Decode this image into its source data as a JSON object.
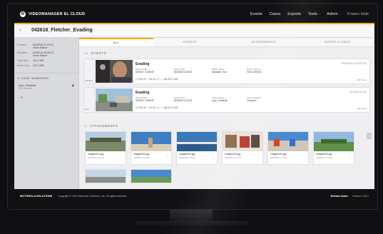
{
  "app": {
    "logo_letter": "M",
    "brand": "VIDEOMANAGER EL CLOUD"
  },
  "topnav": {
    "events": "Events",
    "cases": "Cases",
    "exports": "Exports",
    "tools": "Tools ·",
    "admin": "Admin ·",
    "user": "Kristen Hale"
  },
  "case": {
    "back": "‹",
    "title": "042618_Fletcher_Evading"
  },
  "sidebar": {
    "fields": [
      {
        "k": "Created",
        "v": "04/26/18 11:29:23",
        "v2": "Devin Blauer"
      },
      {
        "k": "Modified",
        "v": "04/26/18 15:26:13",
        "v2": "Devin Blauer"
      },
      {
        "k": "Total Size",
        "v": "115.3 MB",
        "v2": ""
      },
      {
        "k": "Event Size",
        "v": "107.1 MB",
        "v2": ""
      }
    ],
    "case_workers_heading": "CASE WORKERS",
    "worker_name": "Lyon, Christina",
    "worker_role": "Full Access",
    "add": "+"
  },
  "tabs": [
    "ALL",
    "EVENTS",
    "ATTACHMENTS",
    "NOTES & LINKS"
  ],
  "events_heading": "EVENTS",
  "events": [
    {
      "tag": "evsmpsv",
      "title": "Evading",
      "rec_date_label": "Record Date",
      "rec_date": "04/26/17 14:58:09",
      "import_label": "Import Date",
      "import": "04/26/18 11:29:23",
      "officer_label": "Officer Name",
      "officer": "Abraham, Tom",
      "device_label": "Device Source",
      "device": "V301 1000115",
      "icons": "◷ 00m 9s ·  14s   ⊞ 1   ⎙   ⌂   ⌗   ▤ 83.21 MB",
      "right": "00:00:00 (1 of 2) ACTIVE",
      "link": "Add Notes"
    },
    {
      "tag": "sms",
      "title": "Evading",
      "rec_date_label": "Record Date",
      "rec_date": "04/26/17 14:56:09",
      "import_label": "Import Date",
      "import": "04/26/18 11:29:23",
      "officer_label": "Officer Name",
      "officer": "Lyon, Christina",
      "device_label": "Device Source",
      "device": "Pascal13",
      "icons": "◷ 00m 9s ·  17s   ⊞ 1   ⎙   ⌂   ⌗   ▤ 21.23 MB",
      "right": "00:00:26 (2 of 2)",
      "link": "Add Notes"
    }
  ],
  "attachments_heading": "ATTACHMENTS",
  "attachments": [
    {
      "name": "Image0001.jpg",
      "date": "04/26/18 17:16:18"
    },
    {
      "name": "Image0000.jpg",
      "date": "04/26/18 17:16:18"
    },
    {
      "name": "Image0003.jpg",
      "date": "04/26/18 17:16:18"
    },
    {
      "name": "Image0005.jpg",
      "date": "04/26/18 17:16:18"
    },
    {
      "name": "Image0004.jpg",
      "date": "04/26/18 17:16:18"
    },
    {
      "name": "Image0002.jpg",
      "date": "04/26/18 17:16:18"
    }
  ],
  "footer": {
    "brand": "MOTOROLA SOLUTIONS",
    "copyright": "Copyright © 2022 Motorola Solutions, Inc. All rights reserved.",
    "release": "Release Notes",
    "version": "Version 1.00.1"
  },
  "colors": {
    "accent": "#e6b10c",
    "topbar": "#111114",
    "link": "#4a90d9"
  }
}
